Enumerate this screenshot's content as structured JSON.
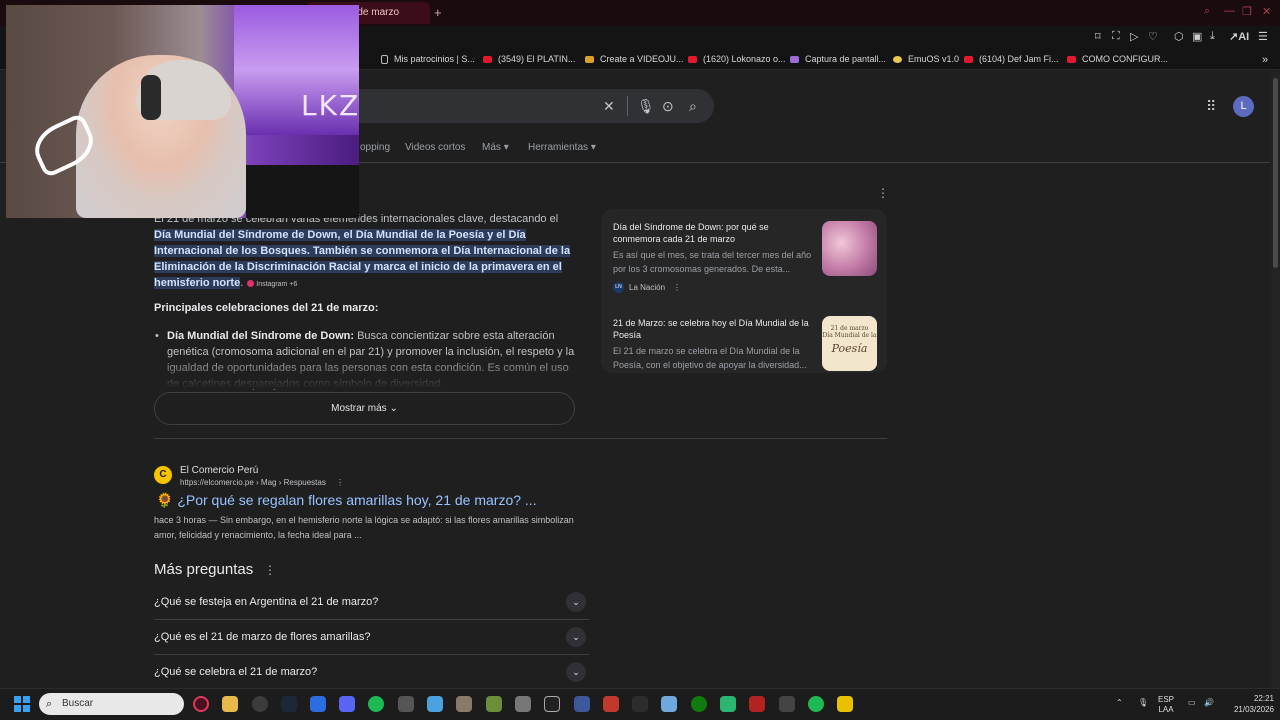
{
  "browser": {
    "active_tab_title": "esteja 21 de marzo",
    "new_tab": "+",
    "window_controls": [
      "search-icon",
      "minimize-icon",
      "restore-icon",
      "close-icon"
    ],
    "toolbar_ai_label": "AI",
    "bookmarks": [
      {
        "label": "Mis patrocinios | S...",
        "icon": "doc"
      },
      {
        "label": "(3549) El PLATIN...",
        "icon": "youtube"
      },
      {
        "label": "Create a VIDEOJU...",
        "icon": "gallery"
      },
      {
        "label": "(1620) Lokonazo o...",
        "icon": "youtube"
      },
      {
        "label": "Captura de pantall...",
        "icon": "capture"
      },
      {
        "label": "EmuOS v1.0",
        "icon": "emuos"
      },
      {
        "label": "(6104) Def Jam Fi...",
        "icon": "youtube"
      },
      {
        "label": "COMO CONFIGUR...",
        "icon": "youtube"
      }
    ]
  },
  "google": {
    "avatar_letter": "L",
    "filters": [
      "opping",
      "Videos cortos",
      "Más",
      "Herramientas"
    ],
    "overview": {
      "intro_hidden": "El 21 de marzo se celebran varias efemérides internacionales clave, destacando el ",
      "intro_visible": "internacionales clave, destacando el ",
      "highlight": "Día Mundial del Síndrome de Down, el Día Mundial de la Poesía y el Día Internacional de los Bosques. También se conmemora el Día Internacional de la Eliminación de la Discriminación Racial y marca el inicio de la primavera en el hemisferio norte",
      "source_chip": "Instagram +6",
      "section_title": "Principales celebraciones del 21 de marzo:",
      "bullet_bold": "Día Mundial del Síndrome de Down:",
      "bullet_text": " Busca concientizar sobre esta alteración genética (cromosoma adicional en el par 21) y promover la inclusión, el respeto y la igualdad de oportunidades para las personas con esta condición. Es común el uso de calcetines desparejados como símbolo de diversidad.",
      "show_more": "Mostrar más"
    },
    "side_cards": [
      {
        "title": "Día del Síndrome de Down: por qué se conmemora cada 21 de marzo",
        "snippet": "Es así que el mes, se trata del tercer mes del año por los 3 cromosomas generados. De esta...",
        "source": "La Nación",
        "source_logo": "LN"
      },
      {
        "title": "21 de Marzo: se celebra hoy el Día Mundial de la Poesía",
        "snippet": "El 21 de marzo se celebra el Día Mundial de la Poesía, con el objetivo de apoyar la diversidad...",
        "thumb_line1": "21 de marzo",
        "thumb_line2": "Día Mundial de la",
        "thumb_line3": "Poesía"
      }
    ],
    "result": {
      "site": "El Comercio Perú",
      "url": "https://elcomercio.pe › Mag › Respuestas",
      "title": "¿Por qué se regalan flores amarillas hoy, 21 de marzo? ...",
      "snippet_time": "hace 3 horas — ",
      "snippet": "Sin embargo, en el hemisferio norte la lógica se adaptó: si las flores amarillas simbolizan amor, felicidad y renacimiento, la fecha ideal para ..."
    },
    "paa": {
      "title": "Más preguntas",
      "questions": [
        "¿Qué se festeja en Argentina el 21 de marzo?",
        "¿Qué es el 21 de marzo de flores amarillas?",
        "¿Qué se celebra el 21 de marzo?"
      ]
    }
  },
  "webcam": {
    "neon_sign": "LKZ"
  },
  "taskbar": {
    "search_placeholder": "Buscar",
    "lang_line1": "ESP",
    "lang_line2": "LAA",
    "time": "22:21",
    "date": "21/03/2026",
    "badge": "99+"
  }
}
